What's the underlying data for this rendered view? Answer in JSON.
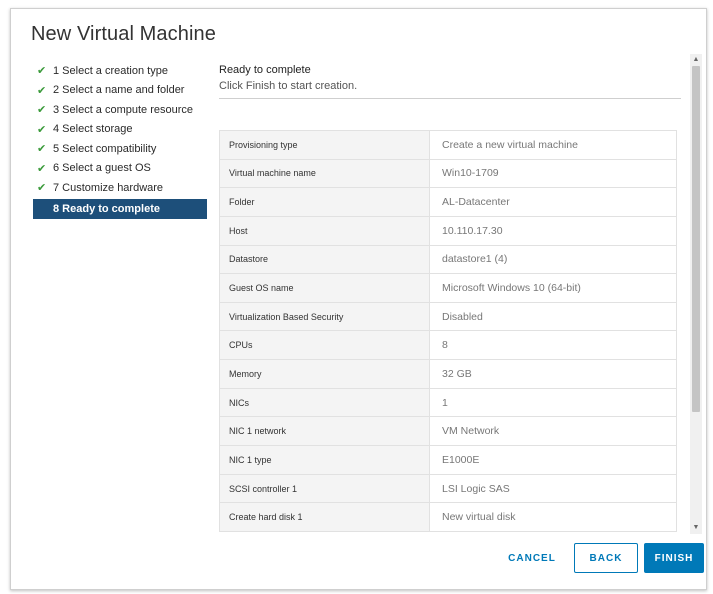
{
  "dialog": {
    "title": "New Virtual Machine"
  },
  "steps": [
    {
      "label": "1 Select a creation type",
      "done": true
    },
    {
      "label": "2 Select a name and folder",
      "done": true
    },
    {
      "label": "3 Select a compute resource",
      "done": true
    },
    {
      "label": "4 Select storage",
      "done": true
    },
    {
      "label": "5 Select compatibility",
      "done": true
    },
    {
      "label": "6 Select a guest OS",
      "done": true
    },
    {
      "label": "7 Customize hardware",
      "done": true
    },
    {
      "label": "8 Ready to complete",
      "done": false,
      "active": true
    }
  ],
  "content": {
    "title": "Ready to complete",
    "subtitle": "Click Finish to start creation."
  },
  "summary": [
    {
      "key": "Provisioning type",
      "value": "Create a new virtual machine"
    },
    {
      "key": "Virtual machine name",
      "value": "Win10-1709"
    },
    {
      "key": "Folder",
      "value": "AL-Datacenter"
    },
    {
      "key": "Host",
      "value": "10.110.17.30"
    },
    {
      "key": "Datastore",
      "value": "datastore1 (4)"
    },
    {
      "key": "Guest OS name",
      "value": "Microsoft Windows 10 (64-bit)"
    },
    {
      "key": "Virtualization Based Security",
      "value": "Disabled"
    },
    {
      "key": "CPUs",
      "value": "8"
    },
    {
      "key": "Memory",
      "value": "32 GB"
    },
    {
      "key": "NICs",
      "value": "1"
    },
    {
      "key": "NIC 1 network",
      "value": "VM Network"
    },
    {
      "key": "NIC 1 type",
      "value": "E1000E"
    },
    {
      "key": "SCSI controller 1",
      "value": "LSI Logic SAS"
    },
    {
      "key": "Create hard disk 1",
      "value": "New virtual disk"
    }
  ],
  "footer": {
    "cancel_label": "CANCEL",
    "back_label": "BACK",
    "finish_label": "FINISH"
  },
  "icons": {
    "check": "check-icon",
    "scroll_up": "scroll-up-arrow-icon",
    "scroll_down": "scroll-down-arrow-icon"
  },
  "colors": {
    "active_step_bg": "#1d4f7a",
    "check_green": "#3a9a3a",
    "primary_blue": "#0079b8"
  }
}
